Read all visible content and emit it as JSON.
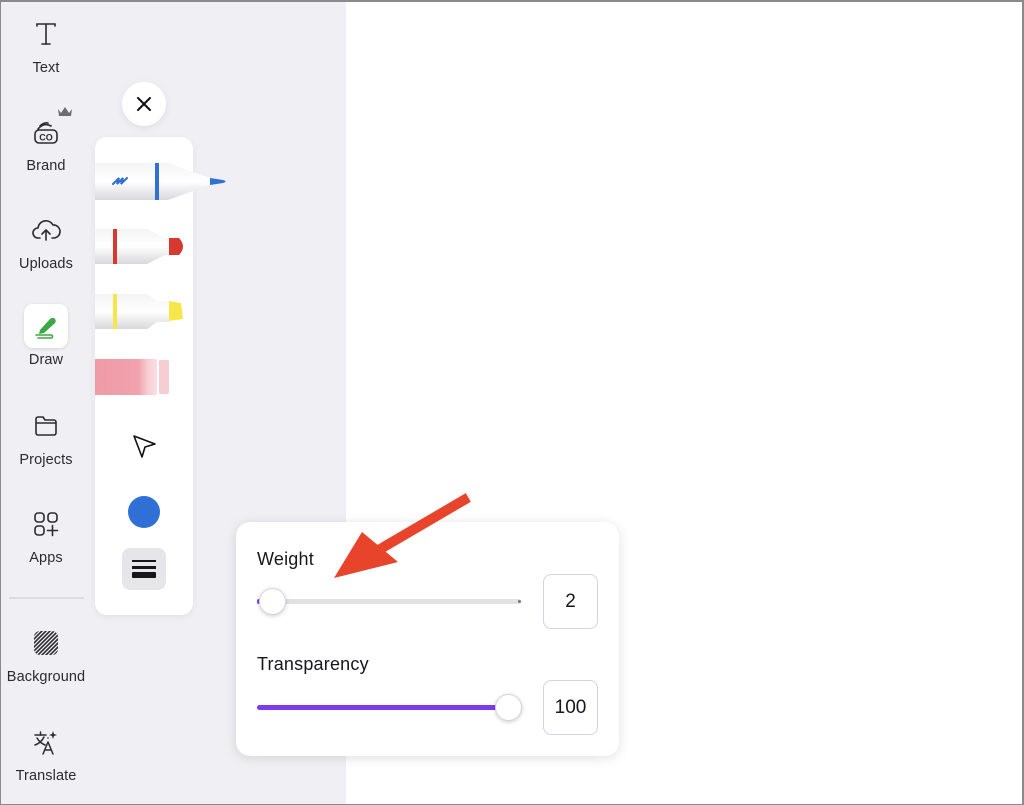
{
  "sidebar": {
    "items": [
      {
        "label": "Text",
        "icon": "text-icon"
      },
      {
        "label": "Brand",
        "icon": "brand-icon",
        "badge": "crown-icon"
      },
      {
        "label": "Uploads",
        "icon": "cloud-upload-icon"
      },
      {
        "label": "Draw",
        "icon": "draw-pen-icon",
        "active": true
      },
      {
        "label": "Projects",
        "icon": "folder-icon"
      },
      {
        "label": "Apps",
        "icon": "apps-grid-icon"
      },
      {
        "label": "Background",
        "icon": "background-hatch-icon"
      },
      {
        "label": "Translate",
        "icon": "translate-icon"
      }
    ]
  },
  "draw_panel": {
    "close_icon": "close-icon",
    "tools": [
      {
        "name": "pen",
        "color": "#2f6fd6"
      },
      {
        "name": "marker",
        "color": "#d63a2f"
      },
      {
        "name": "highlighter",
        "color": "#f7e64a"
      },
      {
        "name": "eraser",
        "color": "#f0a2ad"
      }
    ],
    "select_tool_icon": "pointer-arrow-icon",
    "current_color": "#2f6fd6",
    "weight_tool_icon": "line-weight-icon"
  },
  "settings": {
    "weight": {
      "label": "Weight",
      "value": "2",
      "fraction": 0.0
    },
    "transparency": {
      "label": "Transparency",
      "value": "100",
      "fraction": 1.0
    }
  },
  "colors": {
    "accent": "#7d3cf0",
    "draw_icon_green": "#3aa845",
    "annotation_arrow": "#e8442b"
  }
}
